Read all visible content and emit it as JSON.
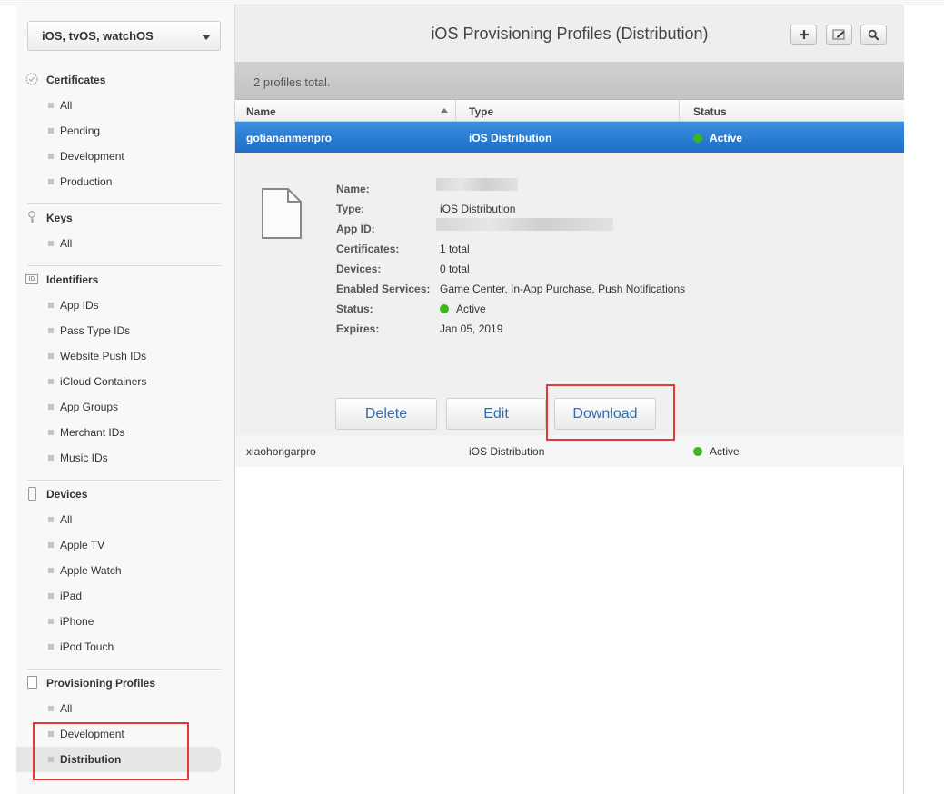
{
  "sidebar": {
    "platform": "iOS, tvOS, watchOS",
    "sections": {
      "certificates": {
        "title": "Certificates",
        "items": [
          "All",
          "Pending",
          "Development",
          "Production"
        ]
      },
      "keys": {
        "title": "Keys",
        "items": [
          "All"
        ]
      },
      "identifiers": {
        "title": "Identifiers",
        "items": [
          "App IDs",
          "Pass Type IDs",
          "Website Push IDs",
          "iCloud Containers",
          "App Groups",
          "Merchant IDs",
          "Music IDs"
        ]
      },
      "devices": {
        "title": "Devices",
        "items": [
          "All",
          "Apple TV",
          "Apple Watch",
          "iPad",
          "iPhone",
          "iPod Touch"
        ]
      },
      "profiles": {
        "title": "Provisioning Profiles",
        "items": [
          "All",
          "Development",
          "Distribution"
        ],
        "selected": "Distribution"
      }
    }
  },
  "header": {
    "title": "iOS Provisioning Profiles (Distribution)",
    "count": "2 profiles total."
  },
  "table": {
    "columns": [
      "Name",
      "Type",
      "Status"
    ],
    "rows": [
      {
        "name": "gotiananmenpro",
        "type": "iOS Distribution",
        "status": "Active",
        "selected": true
      },
      {
        "name": "xiaohongarpro",
        "type": "iOS Distribution",
        "status": "Active",
        "selected": false
      }
    ]
  },
  "detail": {
    "labels": {
      "name": "Name:",
      "type": "Type:",
      "app_id": "App ID:",
      "certificates": "Certificates:",
      "devices": "Devices:",
      "services": "Enabled Services:",
      "status": "Status:",
      "expires": "Expires:"
    },
    "values": {
      "type": "iOS Distribution",
      "certificates": "1 total",
      "devices": "0 total",
      "services": "Game Center, In-App Purchase, Push Notifications",
      "status": "Active",
      "expires": "Jan 05, 2019"
    },
    "actions": {
      "delete": "Delete",
      "edit": "Edit",
      "download": "Download"
    }
  },
  "colors": {
    "accent": "#1c6ec6",
    "active": "#3cb521",
    "highlight": "#e53935"
  },
  "icons": [
    "certificate-icon",
    "key-icon",
    "id-icon",
    "device-icon",
    "document-icon",
    "plus-icon",
    "edit-icon",
    "search-icon",
    "file-icon"
  ]
}
